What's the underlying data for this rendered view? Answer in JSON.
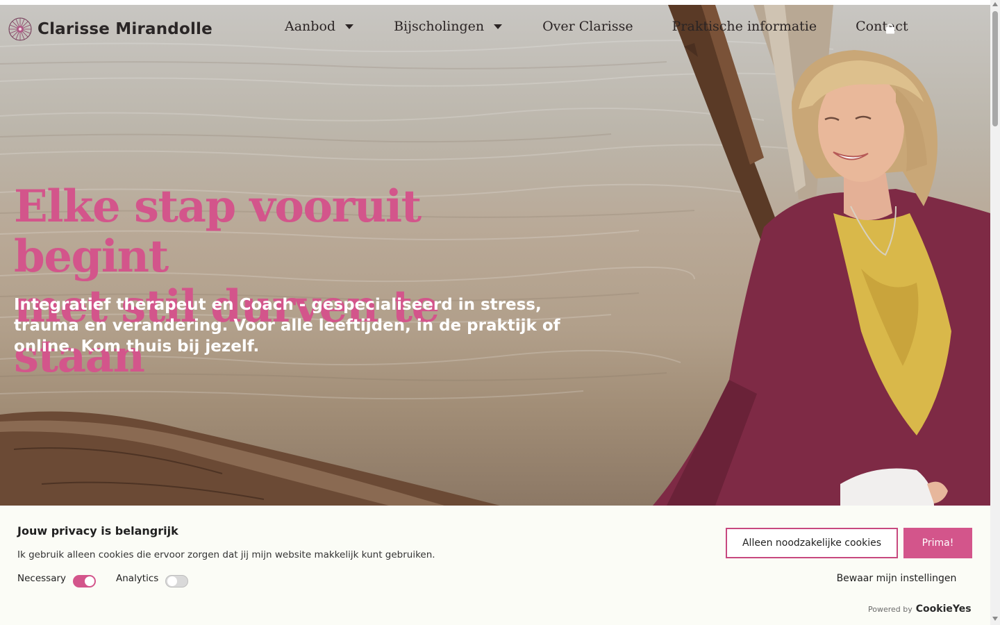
{
  "brand": {
    "name": "Clarisse Mirandolle",
    "logo_icon": "mandala-icon"
  },
  "nav": {
    "items": [
      {
        "label": "Aanbod",
        "has_dropdown": true
      },
      {
        "label": "Bijscholingen",
        "has_dropdown": true
      },
      {
        "label": "Over Clarisse",
        "has_dropdown": false
      },
      {
        "label": "Praktische informatie",
        "has_dropdown": false
      },
      {
        "label": "Contact",
        "has_dropdown": false
      }
    ],
    "cart_icon": "shopping-bag-icon"
  },
  "hero": {
    "headline_line1": "Elke stap vooruit begint",
    "headline_line2": "met stil durven te staan",
    "subline": "Integratief therapeut en Coach - gespecialiseerd in stress, trauma en verandering. Voor alle leeftijden, in de praktijk of online. Kom thuis bij jezelf."
  },
  "cookie_banner": {
    "title": "Jouw privacy is belangrijk",
    "description": "Ik gebruik alleen cookies die ervoor zorgen dat jij mijn website makkelijk kunt gebruiken.",
    "toggles": [
      {
        "label": "Necessary",
        "enabled": true
      },
      {
        "label": "Analytics",
        "enabled": false
      }
    ],
    "necessary_only_label": "Alleen noodzakelijke cookies",
    "accept_label": "Prima!",
    "save_label": "Bewaar mijn instellingen",
    "powered_by_label": "Powered by",
    "powered_by_brand": "CookieYes"
  },
  "colors": {
    "accent": "#d3558b",
    "text_dark": "#2a2424",
    "banner_bg": "#fbfcf6"
  }
}
